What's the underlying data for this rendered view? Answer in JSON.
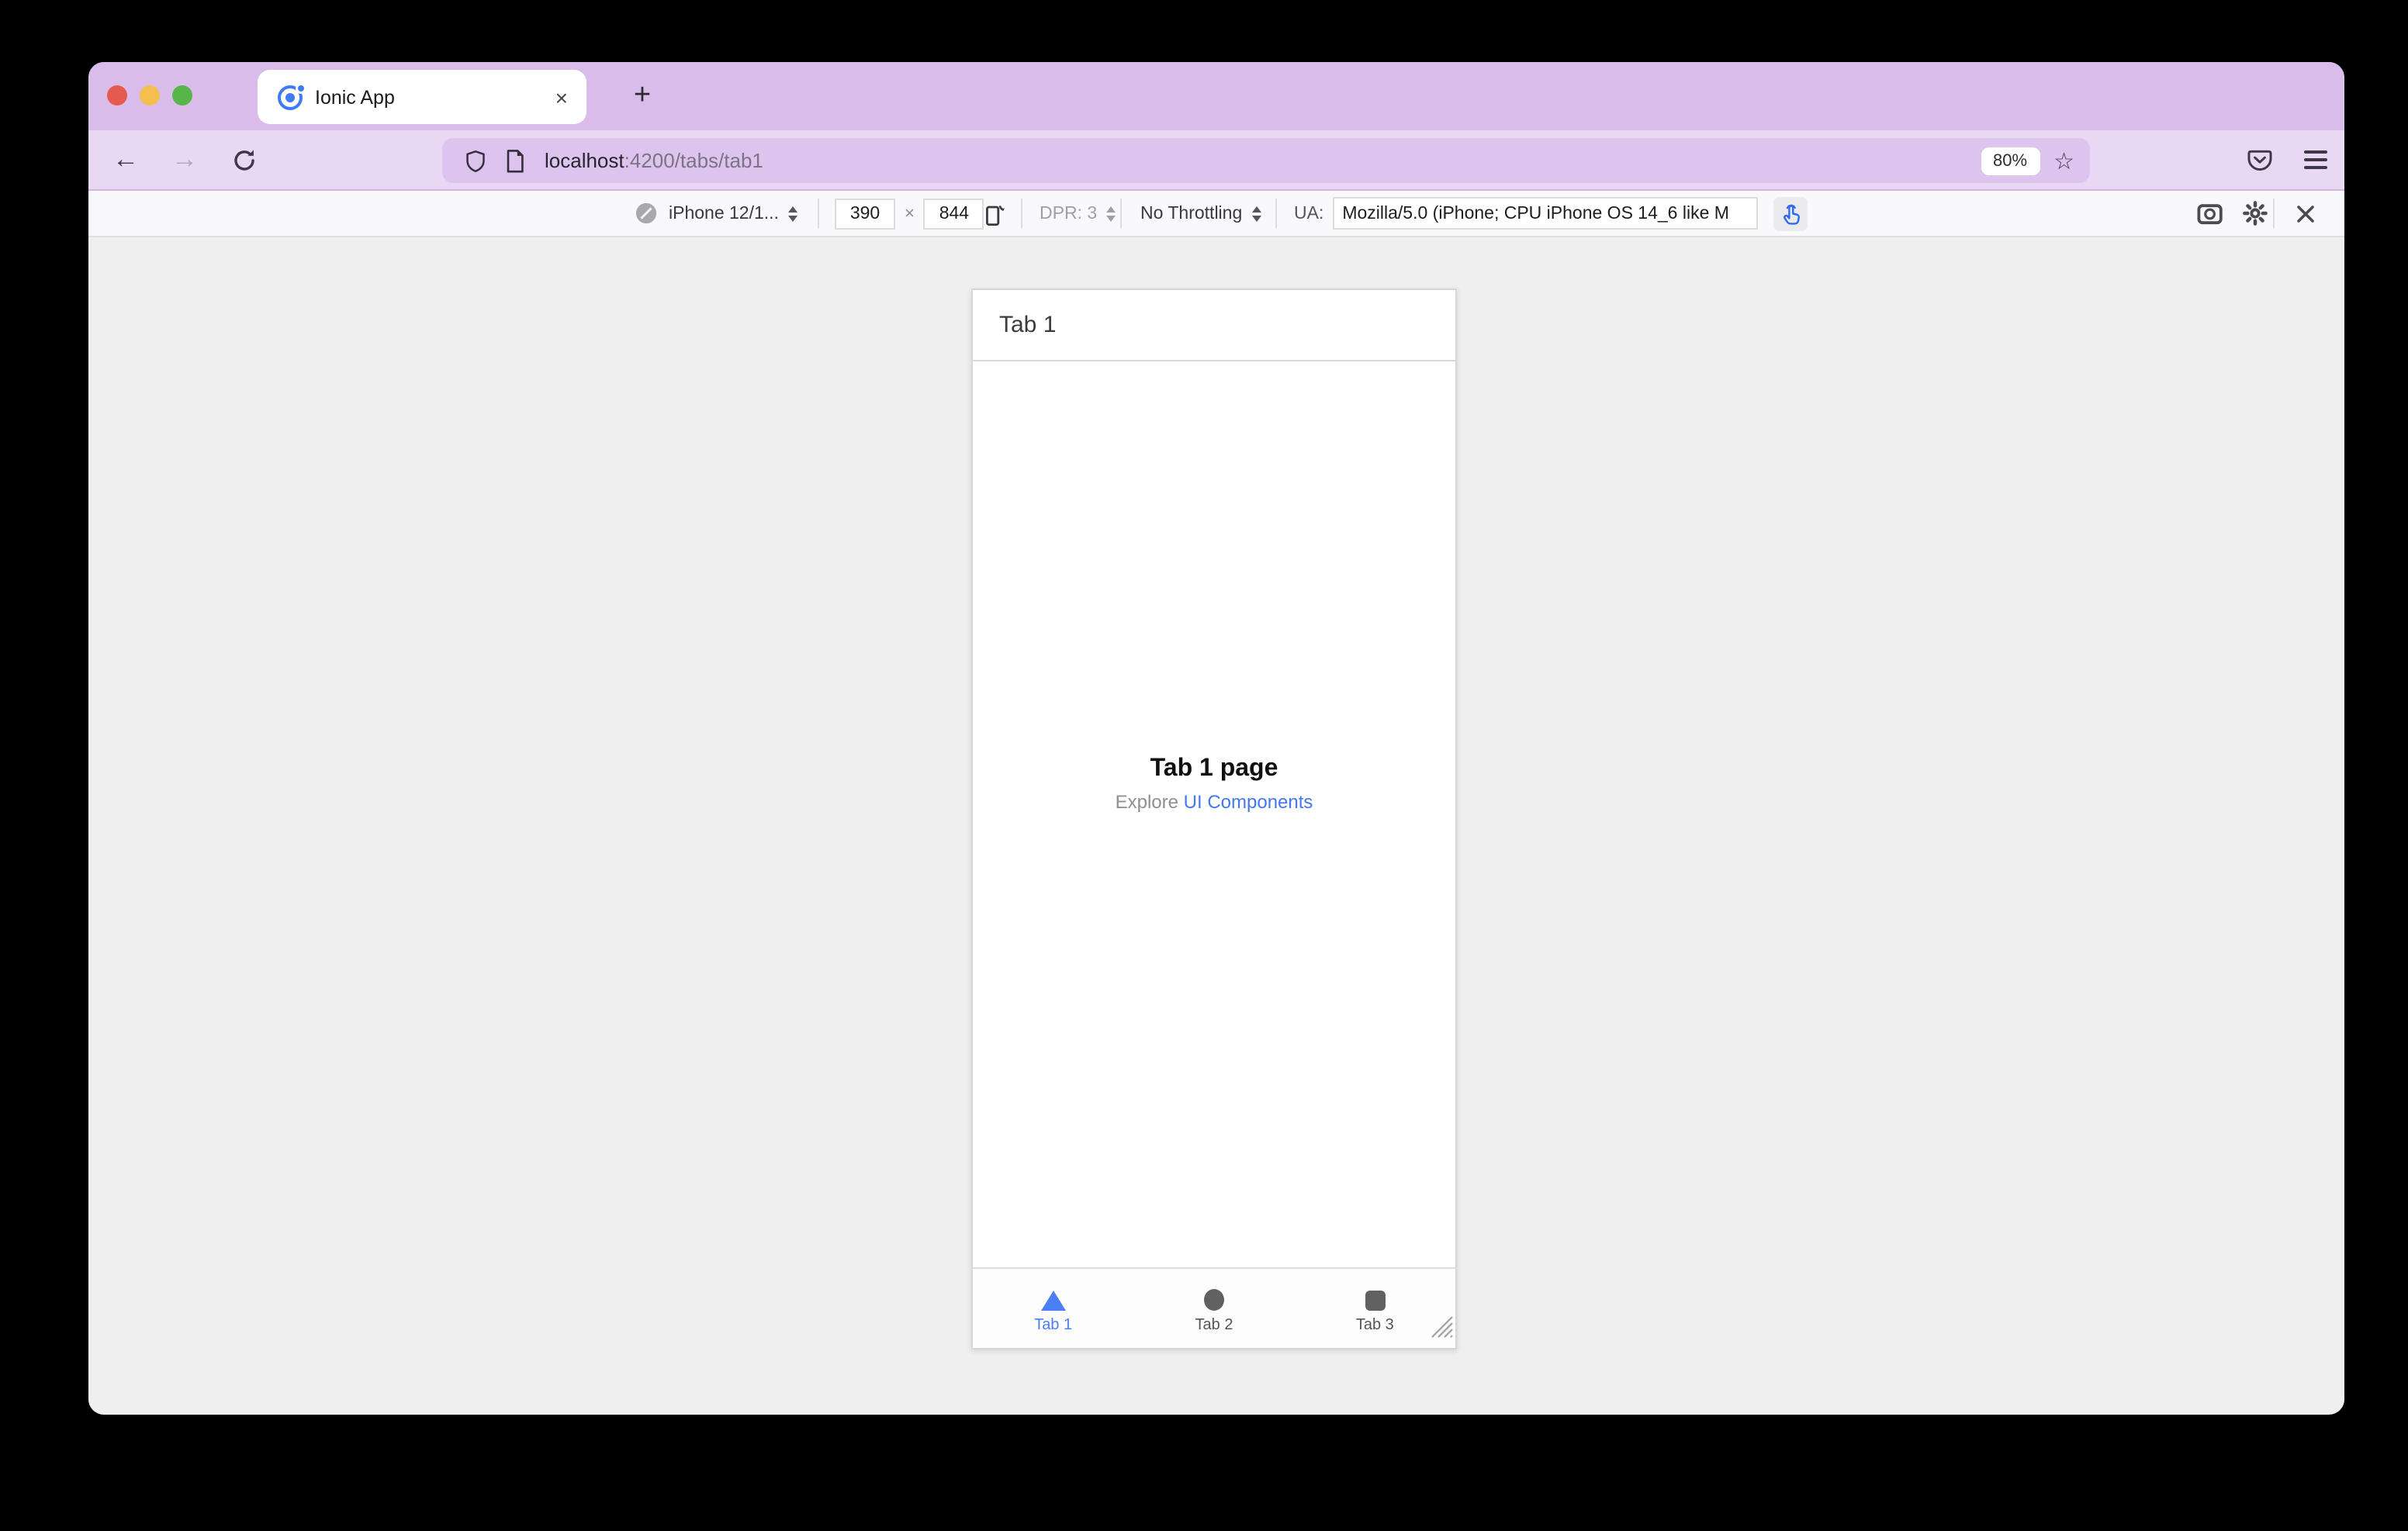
{
  "browser": {
    "tab": {
      "title": "Ionic App"
    },
    "urlbar": {
      "host": "localhost",
      "path": ":4200/tabs/tab1",
      "zoom_badge": "80%"
    },
    "glyphs": {
      "back": "←",
      "forward": "→",
      "new_tab": "+",
      "tab_close": "×",
      "star": "☆",
      "dim_x": "×"
    }
  },
  "rdm_toolbar": {
    "device": "iPhone 12/1...",
    "width_value": "390",
    "height_value": "844",
    "dpr_label": "DPR: 3",
    "throttling_label": "No Throttling",
    "ua_label": "UA:",
    "ua_value": "Mozilla/5.0 (iPhone; CPU iPhone OS 14_6 like M"
  },
  "app": {
    "header_title": "Tab 1",
    "page_title": "Tab 1 page",
    "explore_prefix": "Explore ",
    "explore_link": "UI Components",
    "tabs": [
      {
        "label": "Tab 1",
        "active": true
      },
      {
        "label": "Tab 2",
        "active": false
      },
      {
        "label": "Tab 3",
        "active": false
      }
    ]
  },
  "colors": {
    "titlebar_purple": "#d9bce9",
    "toolbar_purple": "#e8d8f3",
    "urlbar_purple": "#ddc4ef",
    "ionic_primary": "#4c7ef6",
    "link_blue": "#4377f3",
    "touch_icon_blue": "#2e6af0"
  }
}
